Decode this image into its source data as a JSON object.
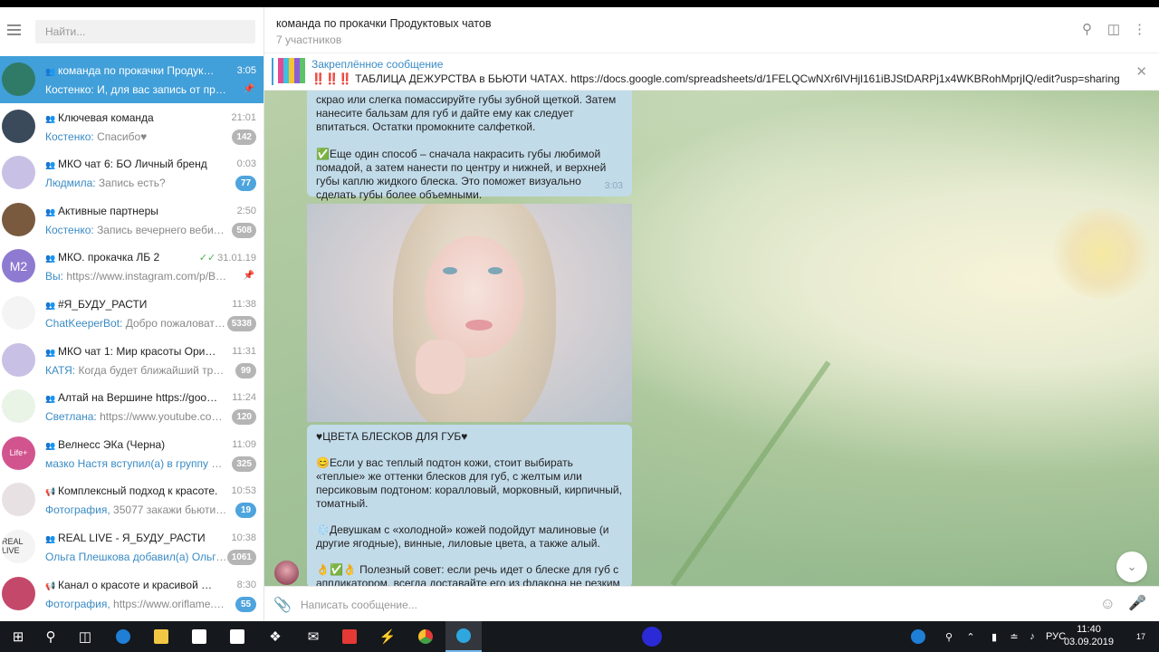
{
  "sidebar": {
    "search_placeholder": "Найти...",
    "chats": [
      {
        "name": "команда по прокачки Продуктов...",
        "time": "3:05",
        "who": "Костенко:",
        "text": "И, для вас запись от профес...",
        "badge": "",
        "pinned": true,
        "active": true,
        "avatar_color": "#2f7b67",
        "avatar_text": ""
      },
      {
        "name": "Ключевая команда",
        "time": "21:01",
        "who": "Костенко:",
        "text": "Спасибо♥",
        "badge": "142",
        "badge_blue": false,
        "avatar_color": "#3b4a5a",
        "avatar_text": ""
      },
      {
        "name": "МКО чат 6: БО Личный бренд",
        "time": "0:03",
        "who": "Людмила:",
        "text": "Запись есть?",
        "badge": "77",
        "badge_blue": true,
        "avatar_color": "#c9c0e6",
        "avatar_text": ""
      },
      {
        "name": "Активные партнеры",
        "time": "2:50",
        "who": "Костенко:",
        "text": "Запись вечернего вебина...",
        "badge": "508",
        "badge_blue": false,
        "avatar_color": "#7a5a3f",
        "avatar_text": ""
      },
      {
        "name": "МКО. прокачка ЛБ 2",
        "time": "31.01.19",
        "who": "Вы:",
        "text": "https://www.instagram.com/p/BtSro...",
        "badge": "",
        "pinned": true,
        "check": true,
        "avatar_color": "#8f7ad1",
        "avatar_text": "М2"
      },
      {
        "name": "#Я_БУДУ_РАСТИ",
        "time": "11:38",
        "who": "ChatKeeperBot:",
        "text": "Добро пожаловать, ...",
        "badge": "5338",
        "badge_blue": false,
        "avatar_color": "#f4f4f4",
        "avatar_text": ""
      },
      {
        "name": "МКО чат 1: Мир красоты Орифл...",
        "time": "11:31",
        "who": "КАТЯ:",
        "text": "Когда будет ближайший тренинг?",
        "badge": "99",
        "badge_blue": false,
        "avatar_color": "#c9c0e6",
        "avatar_text": ""
      },
      {
        "name": "Алтай на Вершине https://goo.gl/...",
        "time": "11:24",
        "who": "Светлана:",
        "text": "https://www.youtube.com/...",
        "badge": "120",
        "badge_blue": false,
        "avatar_color": "#e9f3e6",
        "avatar_text": ""
      },
      {
        "name": "Велнесс ЭКа (Черна)",
        "time": "11:09",
        "who": "",
        "text": "мазко Настя вступил(а) в группу по с...",
        "who_highlight": true,
        "badge": "325",
        "badge_blue": false,
        "avatar_color": "#d2548f",
        "avatar_text": "Life+"
      },
      {
        "name": "Комплексный подход к красоте.",
        "time": "10:53",
        "who": "Фотография,",
        "text": "35077 закажи бьюти-про...",
        "badge": "19",
        "badge_blue": true,
        "channel": true,
        "avatar_color": "#e8e1e4",
        "avatar_text": ""
      },
      {
        "name": "REAL LIVE - Я_БУДУ_РАСТИ",
        "time": "10:38",
        "who": "Ольга Плешкова добавил(а) Ольга ...",
        "text": "",
        "badge": "1061",
        "badge_blue": false,
        "avatar_color": "#f4f4f4",
        "avatar_text": "REAL LIVE"
      },
      {
        "name": "Канал о красоте и красивой жизни",
        "time": "8:30",
        "who": "Фотография,",
        "text": "https://www.oriflame.ru/p...",
        "badge": "55",
        "badge_blue": true,
        "channel": true,
        "avatar_color": "#c4486a",
        "avatar_text": ""
      }
    ]
  },
  "header": {
    "title": "команда по прокачки Продуктовых чатов",
    "subtitle": "7 участников"
  },
  "pinned": {
    "label": "Закреплённое сообщение",
    "text": "‼️‼️‼️ ТАБЛИЦА ДЕЖУРСТВА в БЬЮТИ ЧАТАХ.  https://docs.google.com/spreadsheets/d/1FELQCwNXr6lVHjl161iBJStDARPj1x4WKBRohMprjIQ/edit?usp=sharing"
  },
  "messages": {
    "m1_line1": "скрао или слегка помассируйте губы зубной щеткой. Затем нанесите бальзам для губ и дайте ему как следует впитаться. Остатки промокните салфеткой.",
    "m1_line2": "✅Еще один способ – сначала накрасить губы любимой помадой, а затем нанести по центру и нижней, и верхней губы каплю жидкого блеска. Это поможет визуально сделать губы более объемными.",
    "m1_time": "3:03",
    "m2_title": "♥ЦВЕТА БЛЕСКОВ ДЛЯ ГУБ♥",
    "m2_p1": "😊Если у вас теплый подтон кожи, стоит выбирать «теплые» же оттенки блесков для губ, с желтым или персиковым подтоном: коралловый, морковный, кирпичный, томатный.",
    "m2_p2": "❄️Девушкам с «холодной» кожей подойдут малиновые (и другие ягодные), винные, лиловые цвета, а также алый.",
    "m2_p3": "👌✅👌 Полезный совет: если речь идет о блеске для губ с аппликатором, всегда доставайте его из флакона не резким выдергивающим движением, а медленным"
  },
  "composer": {
    "placeholder": "Написать сообщение..."
  },
  "taskbar": {
    "lang": "РУС",
    "time": "11:40",
    "date": "03.09.2019",
    "notif_count": "17"
  },
  "colors": {
    "accent": "#419fd9",
    "bubble": "#c2dbe9",
    "taskbar": "#15181d"
  }
}
